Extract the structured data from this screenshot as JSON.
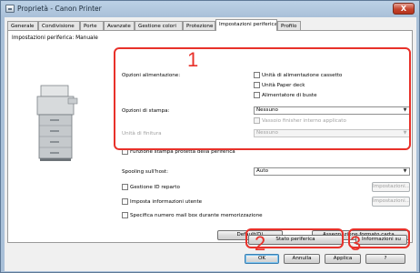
{
  "window": {
    "title": "Proprietà - Canon Printer",
    "close_glyph": "X"
  },
  "tabs": [
    {
      "label": "Generale"
    },
    {
      "label": "Condivisione"
    },
    {
      "label": "Porte"
    },
    {
      "label": "Avanzate"
    },
    {
      "label": "Gestione colori"
    },
    {
      "label": "Protezione"
    },
    {
      "label": "Impostazioni periferica"
    },
    {
      "label": "Profilo"
    }
  ],
  "active_tab": "Impostazioni periferica",
  "panel": {
    "title": "Impostazioni periferica: Manuale",
    "paper_source_label": "Opzioni alimentazione:",
    "paper_source_options": [
      {
        "label": "Unità di alimentazione cassetto",
        "checked": false
      },
      {
        "label": "Unità Paper deck",
        "checked": false
      },
      {
        "label": "Alimentatore di buste",
        "checked": false
      }
    ],
    "output_label": "Opzioni di stampa:",
    "output_value": "Nessuno",
    "finisher_label": "Vassoio finisher interno applicato",
    "finisher_checked": false,
    "finisher_unit_label": "Unità di finitura",
    "finisher_unit_value": "Nessuno",
    "secure_print_label": "Funzione stampa protetta della periferica",
    "spooling_label": "Spooling sull'host:",
    "spooling_value": "Auto",
    "dept_id_label": "Gestione ID reparto",
    "dept_id_settings": "Impostazioni...",
    "user_info_label": "Imposta informazioni utente",
    "user_info_settings": "Impostazioni...",
    "mailbox_label": "Specifica numero mail box durante memorizzazione",
    "defaults_button": "Default(D)",
    "format_assign_button": "Assegnazione formato carta...",
    "device_status_button": "Stato periferica",
    "about_button": "Informazioni su"
  },
  "footer": {
    "ok": "OK",
    "cancel": "Annulla",
    "apply": "Applica",
    "help": "?"
  },
  "callouts": {
    "one": "1",
    "two": "2",
    "three": "3",
    "color": "#e8312a"
  },
  "icons": [
    "app-icon",
    "close-icon",
    "printer-icon",
    "dropdown-arrow-icon"
  ]
}
